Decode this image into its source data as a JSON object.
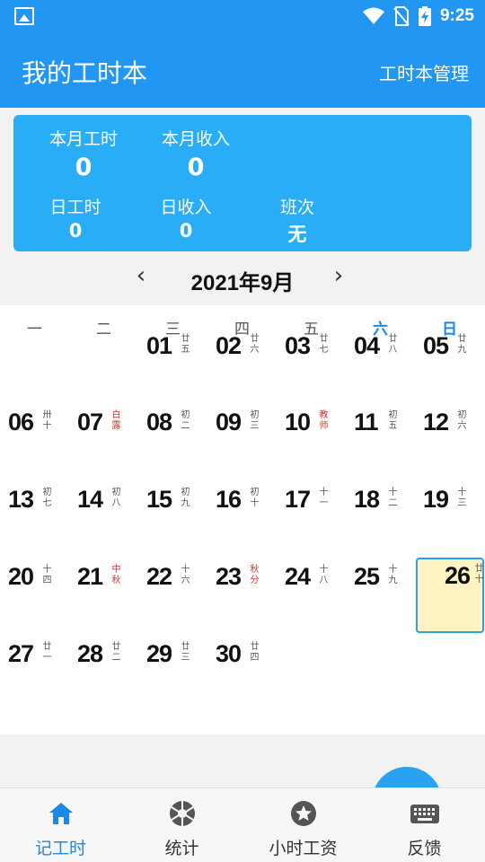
{
  "status_bar": {
    "time": "9:25",
    "icons": [
      "image-icon",
      "wifi-icon",
      "no-sim-icon",
      "battery-charging-icon"
    ]
  },
  "app_bar": {
    "title": "我的工时本",
    "manage_label": "工时本管理"
  },
  "summary": {
    "month_hours_label": "本月工时",
    "month_hours_value": "0",
    "month_income_label": "本月收入",
    "month_income_value": "0",
    "day_hours_label": "日工时",
    "day_hours_value": "0",
    "day_income_label": "日收入",
    "day_income_value": "0",
    "shift_label": "班次",
    "shift_value": "无"
  },
  "calendar": {
    "month_label": "2021年9月",
    "prev_arrow": "‹",
    "next_arrow": "›",
    "weekdays": [
      "一",
      "二",
      "三",
      "四",
      "五",
      "六",
      "日"
    ],
    "days": [
      {
        "num": "01",
        "lunar": "廿五"
      },
      {
        "num": "02",
        "lunar": "廿六"
      },
      {
        "num": "03",
        "lunar": "廿七"
      },
      {
        "num": "04",
        "lunar": "廿八"
      },
      {
        "num": "05",
        "lunar": "廿九"
      },
      {
        "num": "06",
        "lunar": "卅十"
      },
      {
        "num": "07",
        "lunar": "白露",
        "festival": true
      },
      {
        "num": "08",
        "lunar": "初二"
      },
      {
        "num": "09",
        "lunar": "初三"
      },
      {
        "num": "10",
        "lunar": "教师",
        "festival": true
      },
      {
        "num": "11",
        "lunar": "初五"
      },
      {
        "num": "12",
        "lunar": "初六"
      },
      {
        "num": "13",
        "lunar": "初七"
      },
      {
        "num": "14",
        "lunar": "初八"
      },
      {
        "num": "15",
        "lunar": "初九"
      },
      {
        "num": "16",
        "lunar": "初十"
      },
      {
        "num": "17",
        "lunar": "十一"
      },
      {
        "num": "18",
        "lunar": "十二"
      },
      {
        "num": "19",
        "lunar": "十三"
      },
      {
        "num": "20",
        "lunar": "十四"
      },
      {
        "num": "21",
        "lunar": "中秋",
        "festival": true
      },
      {
        "num": "22",
        "lunar": "十六"
      },
      {
        "num": "23",
        "lunar": "秋分",
        "festival": true
      },
      {
        "num": "24",
        "lunar": "十八"
      },
      {
        "num": "25",
        "lunar": "十九"
      },
      {
        "num": "26",
        "lunar": "廿十",
        "selected": true
      },
      {
        "num": "27",
        "lunar": "廿一"
      },
      {
        "num": "28",
        "lunar": "廿二"
      },
      {
        "num": "29",
        "lunar": "廿三"
      },
      {
        "num": "30",
        "lunar": "廿四"
      }
    ],
    "first_weekday_index": 2
  },
  "tabs": [
    {
      "label": "记工时",
      "icon": "home-icon",
      "active": true
    },
    {
      "label": "统计",
      "icon": "aperture-icon",
      "active": false
    },
    {
      "label": "小时工资",
      "icon": "star-circle-icon",
      "active": false
    },
    {
      "label": "反馈",
      "icon": "keyboard-icon",
      "active": false
    }
  ],
  "colors": {
    "primary": "#2196f3",
    "summary_bg": "#29adf7",
    "selected_bg": "#fff3c4",
    "festival_red": "#d32f2f",
    "active_tab": "#1e88e5"
  }
}
